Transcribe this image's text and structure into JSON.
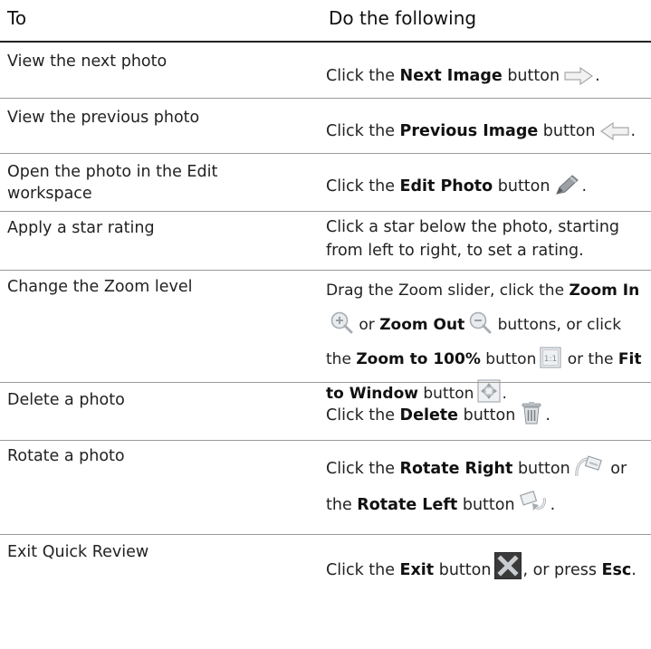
{
  "header": {
    "col1": "To",
    "col2": "Do the following"
  },
  "rows": [
    {
      "task": "View the next photo",
      "parts": [
        "Click the ",
        "Next Image",
        " button",
        "."
      ]
    },
    {
      "task": "View the previous photo",
      "parts": [
        "Click the ",
        "Previous Image",
        " button",
        "."
      ]
    },
    {
      "task": "Open the photo in the Edit workspace",
      "parts": [
        "Click the ",
        "Edit Photo",
        " button",
        "."
      ]
    },
    {
      "task": "Apply a star rating",
      "text": "Click a star below the photo, starting from left to right, to set a rating."
    },
    {
      "task": "Change the Zoom level",
      "parts": [
        "Drag the Zoom slider, click the ",
        "Zoom In",
        " or ",
        "Zoom Out",
        " buttons, or click the ",
        "Zoom to 100%",
        " button",
        " or the ",
        "Fit to Window",
        " button",
        "."
      ]
    },
    {
      "task": "Delete a photo",
      "parts": [
        "Click the ",
        "Delete",
        " button",
        "."
      ]
    },
    {
      "task": "Rotate a photo",
      "parts": [
        "Click the ",
        "Rotate Right",
        " button",
        " or the ",
        "Rotate Left",
        " button",
        "."
      ]
    },
    {
      "task": "Exit Quick Review",
      "parts": [
        "Click the ",
        "Exit",
        " button",
        ", or press ",
        "Esc",
        "."
      ]
    }
  ],
  "icons": {
    "next": "arrow-right-icon",
    "previous": "arrow-left-icon",
    "edit": "pencil-icon",
    "zoom_in": "zoom-in-icon",
    "zoom_out": "zoom-out-icon",
    "zoom_100": "zoom-100-icon",
    "fit": "fit-to-window-icon",
    "delete": "trash-icon",
    "rotate_right": "rotate-right-icon",
    "rotate_left": "rotate-left-icon",
    "exit": "close-icon"
  },
  "colors": {
    "rule": "#9a9a9a",
    "header_rule": "#222222"
  }
}
